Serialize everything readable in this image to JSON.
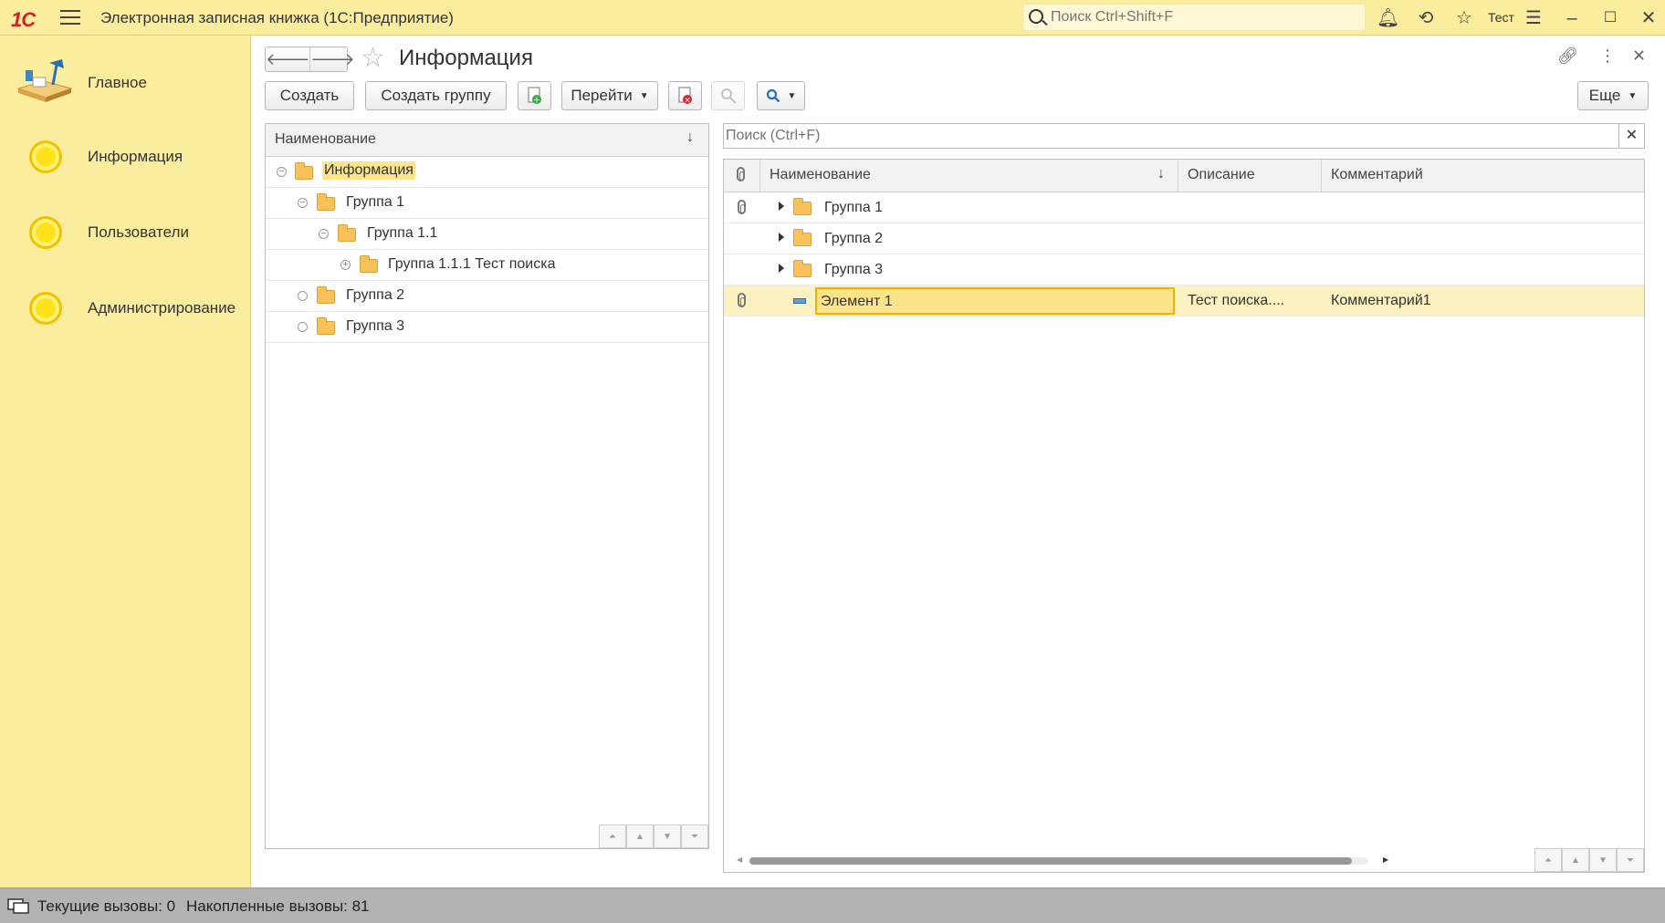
{
  "titlebar": {
    "app_title": "Электронная записная книжка  (1С:Предприятие)",
    "search_placeholder": "Поиск Ctrl+Shift+F",
    "user": "Тест"
  },
  "sidebar": {
    "items": [
      {
        "label": "Главное"
      },
      {
        "label": "Информация"
      },
      {
        "label": "Пользователи"
      },
      {
        "label": "Администрирование"
      }
    ]
  },
  "form": {
    "title": "Информация"
  },
  "toolbar": {
    "create": "Создать",
    "create_group": "Создать группу",
    "goto": "Перейти",
    "more": "Еще"
  },
  "tree": {
    "header": "Наименование",
    "rows": [
      {
        "label": "Информация"
      },
      {
        "label": "Группа 1"
      },
      {
        "label": "Группа 1.1"
      },
      {
        "label": "Группа 1.1.1 Тест поиска"
      },
      {
        "label": "Группа 2"
      },
      {
        "label": "Группа 3"
      }
    ]
  },
  "list": {
    "search_placeholder": "Поиск (Ctrl+F)",
    "columns": {
      "name": "Наименование",
      "description": "Описание",
      "comment": "Комментарий"
    },
    "rows": [
      {
        "name": "Группа 1",
        "description": "",
        "comment": ""
      },
      {
        "name": "Группа 2",
        "description": "",
        "comment": ""
      },
      {
        "name": "Группа 3",
        "description": "",
        "comment": ""
      },
      {
        "name": "Элемент 1",
        "description": "Тест поиска....",
        "comment": "Комментарий1"
      }
    ]
  },
  "status": {
    "current_calls": "Текущие вызовы: 0",
    "accumulated_calls": "Накопленные вызовы: 81"
  },
  "colors": {
    "panel_bg": "#fbed9e",
    "selection": "#fbe48a",
    "status_bg": "#b3b3b3"
  }
}
